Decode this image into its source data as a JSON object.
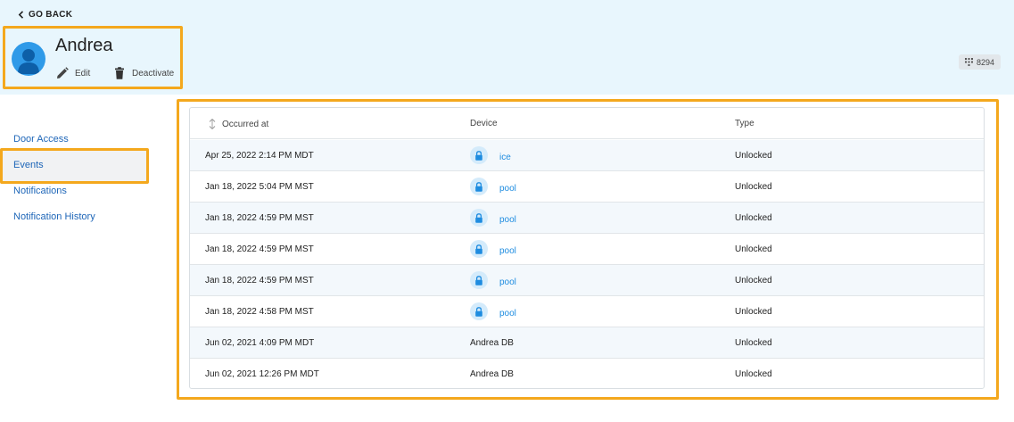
{
  "header": {
    "go_back": "GO BACK",
    "user_name": "Andrea",
    "edit_label": "Edit",
    "deactivate_label": "Deactivate",
    "pin_code": "8294"
  },
  "sidebar": {
    "items": [
      {
        "label": "Door Access"
      },
      {
        "label": "Events",
        "selected": true
      },
      {
        "label": "Notifications"
      },
      {
        "label": "Notification History"
      }
    ]
  },
  "table": {
    "headers": {
      "occurred_at": "Occurred at",
      "device": "Device",
      "type": "Type"
    },
    "rows": [
      {
        "occurred_at": "Apr 25, 2022 2:14 PM MDT",
        "device": "ice",
        "type": "Unlocked"
      },
      {
        "occurred_at": "Jan 18, 2022 5:04 PM MST",
        "device": "pool",
        "type": "Unlocked"
      },
      {
        "occurred_at": "Jan 18, 2022 4:59 PM MST",
        "device": "pool",
        "type": "Unlocked"
      },
      {
        "occurred_at": "Jan 18, 2022 4:59 PM MST",
        "device": "pool",
        "type": "Unlocked"
      },
      {
        "occurred_at": "Jan 18, 2022 4:59 PM MST",
        "device": "pool",
        "type": "Unlocked"
      },
      {
        "occurred_at": "Jan 18, 2022 4:58 PM MST",
        "device": "pool",
        "type": "Unlocked"
      },
      {
        "occurred_at": "Jun 02, 2021 4:09 PM MDT",
        "device": "Andrea DB",
        "type": "Unlocked"
      },
      {
        "occurred_at": "Jun 02, 2021 12:26 PM MDT",
        "device": "Andrea DB",
        "type": "Unlocked"
      }
    ]
  },
  "colors": {
    "header_bg": "#e8f6fd",
    "highlight": "#f4a81d",
    "link": "#1e8ce0",
    "nav_link": "#1e66b8",
    "avatar": "#2f9ae8"
  }
}
